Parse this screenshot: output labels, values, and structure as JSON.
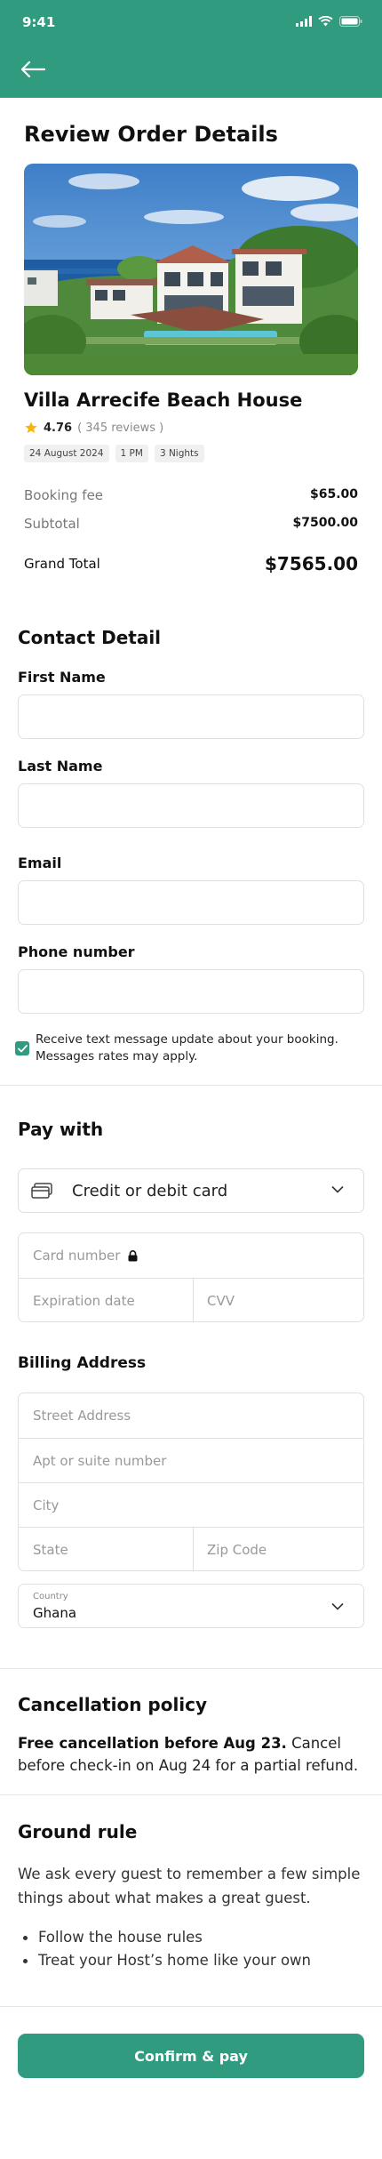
{
  "status_bar": {
    "time": "9:41"
  },
  "page": {
    "title": "Review Order Details"
  },
  "listing": {
    "name": "Villa Arrecife Beach House",
    "rating": "4.76",
    "reviews": "( 345 reviews )",
    "chips": [
      "24 August 2024",
      "1 PM",
      "3 Nights"
    ]
  },
  "pricing": {
    "booking_fee_label": "Booking fee",
    "booking_fee": "$65.00",
    "subtotal_label": "Subtotal",
    "subtotal": "$7500.00",
    "grand_total_label": "Grand Total",
    "grand_total": "$7565.00"
  },
  "contact": {
    "title": "Contact Detail",
    "first_name_label": "First Name",
    "first_name_value": "",
    "last_name_label": "Last Name",
    "last_name_value": "",
    "email_label": "Email",
    "email_value": "",
    "phone_label": "Phone number",
    "phone_value": "",
    "sms_opt_in_checked": true,
    "sms_opt_in_text": "Receive text message update about your booking. Messages rates may apply."
  },
  "payment": {
    "title": "Pay with",
    "method": "Credit or debit card",
    "card_number_placeholder": "Card number",
    "expiration_placeholder": "Expiration date",
    "cvv_placeholder": "CVV"
  },
  "billing": {
    "title": "Billing Address",
    "street_placeholder": "Street Address",
    "apt_placeholder": "Apt or suite number",
    "city_placeholder": "City",
    "state_placeholder": "State",
    "zip_placeholder": "Zip Code",
    "country_caption": "Country",
    "country_value": "Ghana"
  },
  "cancellation": {
    "title": "Cancellation policy",
    "bold_text": "Free cancellation before Aug 23.",
    "rest_text": " Cancel before check-in on Aug 24 for a partial refund."
  },
  "ground_rule": {
    "title": "Ground rule",
    "intro": "We ask every guest to remember a few simple things about what makes a great guest.",
    "items": [
      "Follow the house rules",
      "Treat your Host’s home like your own"
    ]
  },
  "cta": {
    "label": "Confirm & pay"
  },
  "colors": {
    "accent": "#319b80",
    "star": "#f5b50a"
  }
}
